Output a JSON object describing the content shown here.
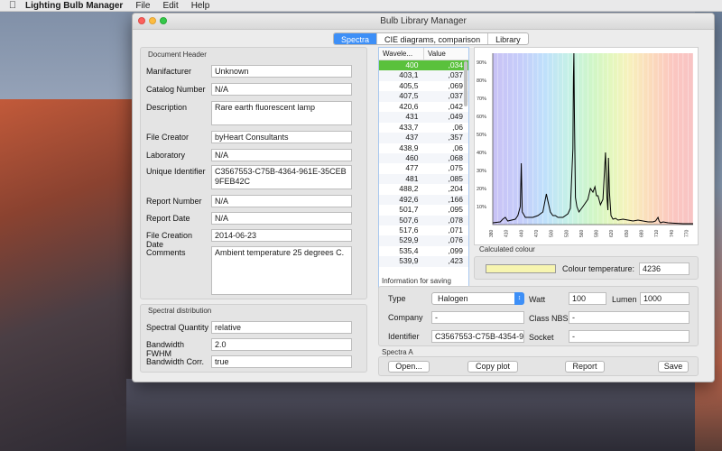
{
  "menubar": {
    "app_name": "Lighting Bulb Manager",
    "menus": [
      "File",
      "Edit",
      "Help"
    ]
  },
  "window": {
    "title": "Bulb Library Manager",
    "tabs": [
      "Spectra",
      "CIE diagrams, comparison",
      "Library"
    ],
    "active_tab": "Spectra"
  },
  "document_header": {
    "group_label": "Document Header",
    "fields": [
      {
        "label": "Manifacturer",
        "value": "Unknown"
      },
      {
        "label": "Catalog Number",
        "value": "N/A"
      },
      {
        "label": "Description",
        "value": "Rare earth fluorescent lamp"
      },
      {
        "label": "File Creator",
        "value": "byHeart Consultants"
      },
      {
        "label": "Laboratory",
        "value": "N/A"
      },
      {
        "label": "Unique Identifier",
        "value": "C3567553-C75B-4364-961E-35CEB9FEB42C"
      },
      {
        "label": "Report Number",
        "value": "N/A"
      },
      {
        "label": "Report Date",
        "value": "N/A"
      },
      {
        "label": "File Creation Date",
        "value": "2014-06-23"
      },
      {
        "label": "Comments",
        "value": "Ambient temperature 25 degrees C."
      }
    ]
  },
  "spectral_distribution": {
    "group_label": "Spectral distribution",
    "fields": [
      {
        "label": "Spectral Quantity",
        "value": "relative"
      },
      {
        "label": "Bandwidth FWHM",
        "value": "2.0"
      },
      {
        "label": "Bandwidth Corr.",
        "value": "true"
      }
    ]
  },
  "data_table": {
    "columns": [
      "Wavele...",
      "Value"
    ],
    "rows": [
      [
        "400",
        ",034"
      ],
      [
        "403,1",
        ",037"
      ],
      [
        "405,5",
        ",069"
      ],
      [
        "407,5",
        ",037"
      ],
      [
        "420,6",
        ",042"
      ],
      [
        "431",
        ",049"
      ],
      [
        "433,7",
        ",06"
      ],
      [
        "437",
        ",357"
      ],
      [
        "438,9",
        ",06"
      ],
      [
        "460",
        ",068"
      ],
      [
        "477",
        ",075"
      ],
      [
        "481",
        ",085"
      ],
      [
        "488,2",
        ",204"
      ],
      [
        "492,6",
        ",166"
      ],
      [
        "501,7",
        ",095"
      ],
      [
        "507,6",
        ",078"
      ],
      [
        "517,6",
        ",071"
      ],
      [
        "529,9",
        ",076"
      ],
      [
        "535,4",
        ",099"
      ],
      [
        "539,9",
        ",423"
      ]
    ],
    "selected_index": 0
  },
  "chart_data": {
    "type": "line",
    "ylabels": [
      "90%",
      "80%",
      "70%",
      "60%",
      "50%",
      "40%",
      "30%",
      "20%",
      "10%"
    ],
    "xlabels": [
      "380",
      "410",
      "440",
      "470",
      "500",
      "530",
      "560",
      "590",
      "620",
      "650",
      "680",
      "710",
      "740",
      "770"
    ],
    "xlim": [
      380,
      780
    ],
    "ylim": [
      0,
      95
    ],
    "series": [
      {
        "x": [
          380,
          395,
          400,
          405,
          410,
          425,
          430,
          435,
          437,
          439,
          445,
          460,
          470,
          480,
          487,
          490,
          495,
          500,
          505,
          510,
          520,
          530,
          535,
          540,
          541,
          542,
          543,
          545,
          548,
          552,
          560,
          570,
          575,
          580,
          584,
          587,
          590,
          595,
          600,
          605,
          608,
          610,
          611,
          613,
          616,
          620,
          625,
          630,
          640,
          650,
          660,
          670,
          680,
          690,
          700,
          705,
          710,
          712,
          715,
          720,
          730,
          740,
          760,
          780
        ],
        "y": [
          1,
          1.5,
          3,
          4,
          2,
          3,
          5,
          10,
          34,
          7,
          4,
          4,
          5,
          7,
          17,
          13,
          7,
          5,
          5,
          4,
          4,
          6,
          9,
          42,
          82,
          95,
          60,
          15,
          10,
          7,
          10,
          14,
          20,
          18,
          21,
          16,
          16,
          11,
          14,
          40,
          15,
          8,
          37,
          18,
          5,
          3,
          3.5,
          2.5,
          3,
          2.5,
          2,
          2.5,
          2,
          1.5,
          1.5,
          2,
          4,
          2,
          1,
          1.5,
          1,
          0.8,
          0.5,
          0.5
        ]
      }
    ],
    "background": "visible spectrum gradient"
  },
  "calculated_colour": {
    "group_label": "Calculated colour",
    "swatch_color": "#f7f5b0",
    "temp_label": "Colour temperature:",
    "temp_value": "4236"
  },
  "info_saving": {
    "group_label": "Information for saving",
    "type_label": "Type",
    "type_value": "Halogen",
    "watt_label": "Watt",
    "watt_value": "100",
    "lumen_label": "Lumen",
    "lumen_value": "1000",
    "company_label": "Company",
    "company_value": "-",
    "classnbs_label": "Class NBS",
    "classnbs_value": "-",
    "identifier_label": "Identifier",
    "identifier_value": "C3567553-C75B-4354-9",
    "socket_label": "Socket",
    "socket_value": "-"
  },
  "spectra_actions": {
    "group_label": "Spectra A",
    "buttons": [
      "Open...",
      "Copy plot",
      "Report",
      "Save"
    ]
  }
}
